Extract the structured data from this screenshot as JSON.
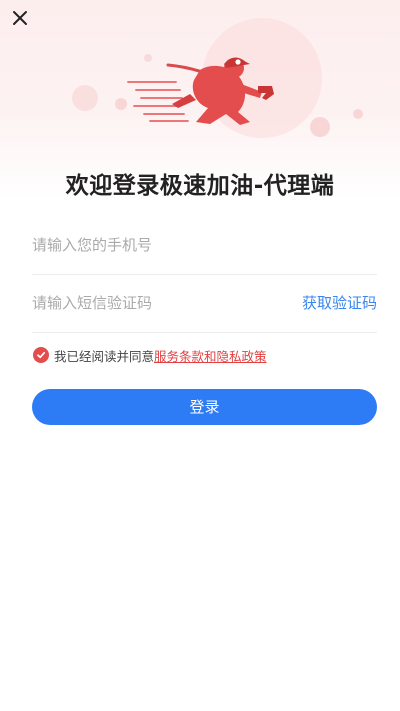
{
  "header": {
    "close_icon": "close-icon"
  },
  "hero": {
    "illustration": "running-fuel-mascot"
  },
  "page_title": "欢迎登录极速加油-代理端",
  "form": {
    "phone_placeholder": "请输入您的手机号",
    "phone_value": "",
    "code_placeholder": "请输入短信验证码",
    "code_value": "",
    "get_code_label": "获取验证码"
  },
  "agreement": {
    "checked": true,
    "prefix": "我已经阅读并同意",
    "link_text": "服务条款和隐私政策"
  },
  "login_button": "登录",
  "colors": {
    "primary_blue": "#2d7cf5",
    "accent_red": "#e34d4d",
    "hero_bg": "#fdeeee"
  }
}
